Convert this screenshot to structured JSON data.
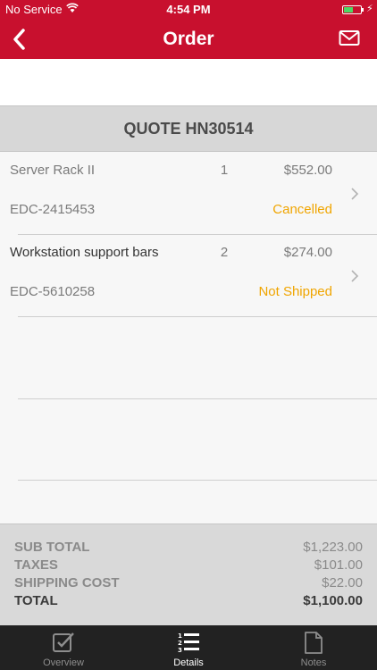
{
  "status_bar": {
    "carrier": "No Service",
    "time": "4:54 PM",
    "battery_level": 0.55
  },
  "nav": {
    "title": "Order",
    "back_icon": "chevron-left-icon",
    "mail_icon": "mail-icon"
  },
  "quote": {
    "title": "QUOTE HN30514"
  },
  "items": [
    {
      "name": "Server Rack II",
      "qty": "1",
      "price": "$552.00",
      "sku": "EDC-2415453",
      "status": "Cancelled",
      "status_color": "#f0a500",
      "name_color": "#7a7a7a"
    },
    {
      "name": "Workstation support bars",
      "qty": "2",
      "price": "$274.00",
      "sku": "EDC-5610258",
      "status": "Not Shipped",
      "status_color": "#f0a500",
      "name_color": "#333333"
    }
  ],
  "totals": {
    "sub_total_label": "SUB TOTAL",
    "sub_total_value": "$1,223.00",
    "taxes_label": "TAXES",
    "taxes_value": "$101.00",
    "shipping_label": "SHIPPING COST",
    "shipping_value": "$22.00",
    "total_label": "TOTAL",
    "total_value": "$1,100.00"
  },
  "tabs": [
    {
      "label": "Overview",
      "icon": "checkbox-icon",
      "active": false
    },
    {
      "label": "Details",
      "icon": "numbered-list-icon",
      "active": true
    },
    {
      "label": "Notes",
      "icon": "document-icon",
      "active": false
    }
  ],
  "colors": {
    "brand": "#c8102e",
    "status": "#f0a500",
    "tab_bar": "#222222"
  }
}
